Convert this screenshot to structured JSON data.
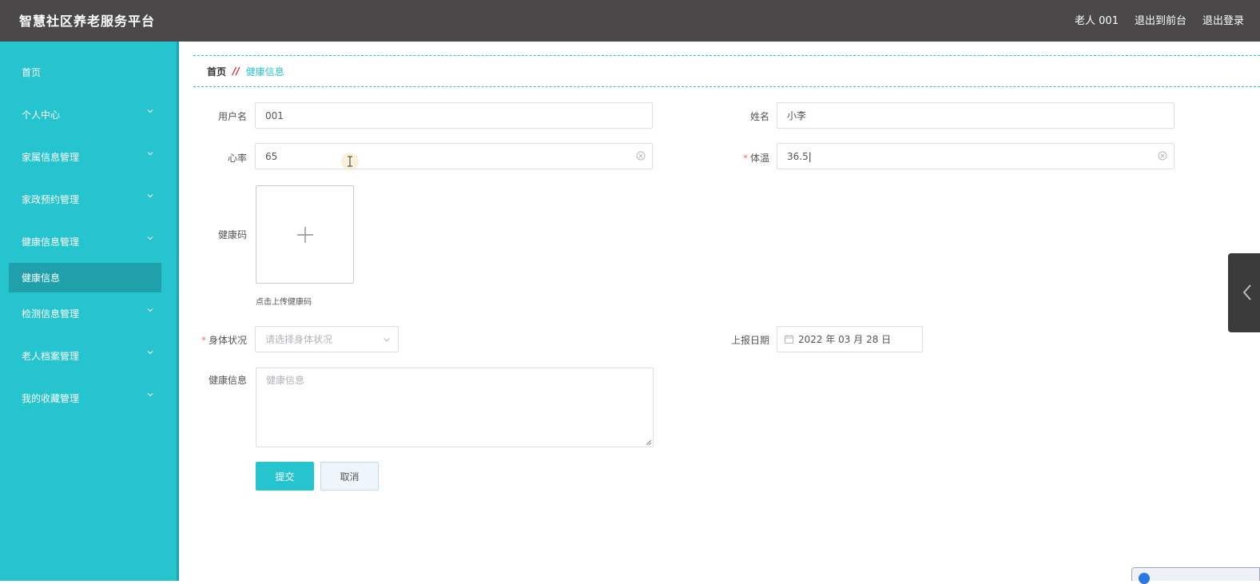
{
  "app": {
    "title": "智慧社区养老服务平台"
  },
  "header": {
    "user": "老人 001",
    "front_link": "退出到前台",
    "logout_link": "退出登录"
  },
  "sidebar": {
    "items": [
      {
        "label": "首页"
      },
      {
        "label": "个人中心"
      },
      {
        "label": "家属信息管理"
      },
      {
        "label": "家政预约管理"
      },
      {
        "label": "健康信息管理"
      },
      {
        "label": "健康信息"
      },
      {
        "label": "检测信息管理"
      },
      {
        "label": "老人档案管理"
      },
      {
        "label": "我的收藏管理"
      }
    ]
  },
  "breadcrumb": {
    "home": "首页",
    "separator": "//",
    "current": "健康信息"
  },
  "form": {
    "username": {
      "label": "用户名",
      "value": "001"
    },
    "name": {
      "label": "姓名",
      "value": "小李"
    },
    "heart_rate": {
      "label": "心率",
      "value": "65"
    },
    "temperature": {
      "label": "体温",
      "value": "36.5",
      "required_mark": "*"
    },
    "health_code": {
      "label": "健康码",
      "tip": "点击上传健康码"
    },
    "condition": {
      "label": "身体状况",
      "placeholder": "请选择身体状况",
      "required_mark": "*"
    },
    "report_date": {
      "label": "上报日期",
      "value": "2022 年 03 月 28 日"
    },
    "health_info": {
      "label": "健康信息",
      "placeholder": "健康信息"
    },
    "submit_label": "提交",
    "cancel_label": "取消"
  },
  "colors": {
    "sidebar": "#26c4ce",
    "header": "#4a4849",
    "accent": "#26c4ce",
    "required": "#f56c6c"
  }
}
